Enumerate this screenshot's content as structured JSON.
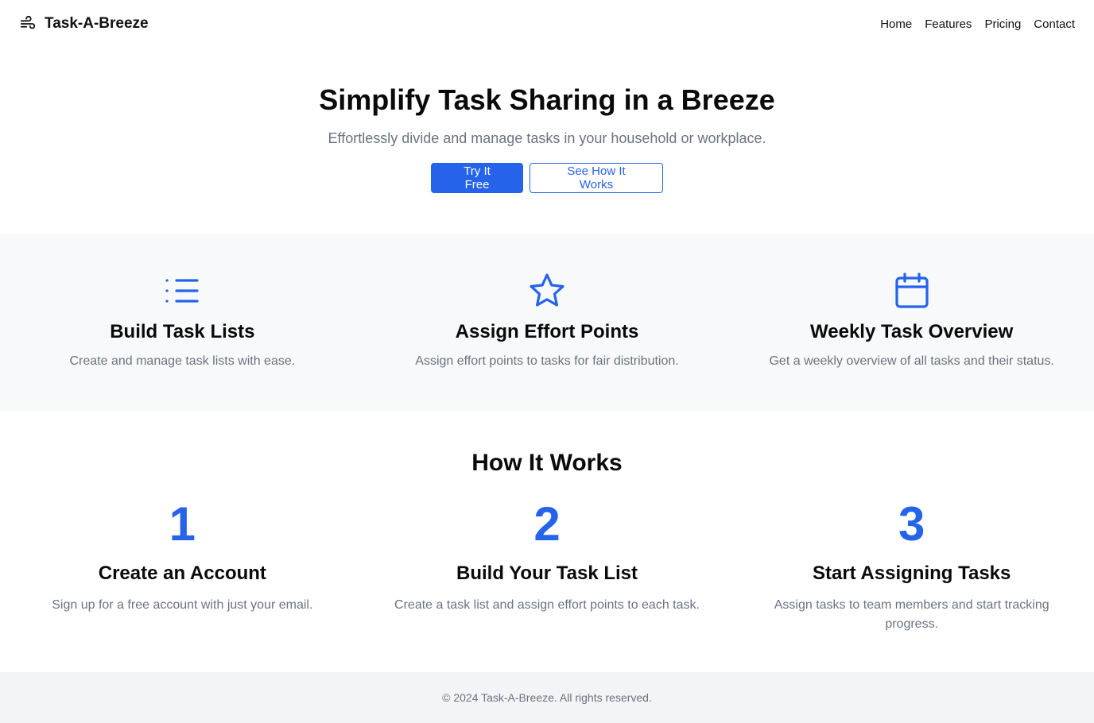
{
  "navbar": {
    "brand_icon": "wind-icon",
    "brand_name": "Task-A-Breeze",
    "links": [
      "Home",
      "Features",
      "Pricing",
      "Contact"
    ]
  },
  "hero": {
    "title": "Simplify Task Sharing in a Breeze",
    "subtitle": "Effortlessly divide and manage tasks in your household or workplace.",
    "primary_button": "Try It Free",
    "secondary_button": "See How It Works"
  },
  "features": [
    {
      "icon": "list-icon",
      "title": "Build Task Lists",
      "description": "Create and manage task lists with ease."
    },
    {
      "icon": "star-icon",
      "title": "Assign Effort Points",
      "description": "Assign effort points to tasks for fair distribution."
    },
    {
      "icon": "calendar-icon",
      "title": "Weekly Task Overview",
      "description": "Get a weekly overview of all tasks and their status."
    }
  ],
  "how_it_works": {
    "title": "How It Works",
    "steps": [
      {
        "number": "1",
        "title": "Create an Account",
        "description": "Sign up for a free account with just your email."
      },
      {
        "number": "2",
        "title": "Build Your Task List",
        "description": "Create a task list and assign effort points to each task."
      },
      {
        "number": "3",
        "title": "Start Assigning Tasks",
        "description": "Assign tasks to team members and start tracking progress."
      }
    ]
  },
  "footer": {
    "copyright": "© 2024 Task-A-Breeze. All rights reserved."
  },
  "colors": {
    "accent": "#2563eb",
    "muted_text": "#6b7280",
    "features_bg": "#f8f9fa",
    "footer_bg": "#f3f4f6"
  }
}
